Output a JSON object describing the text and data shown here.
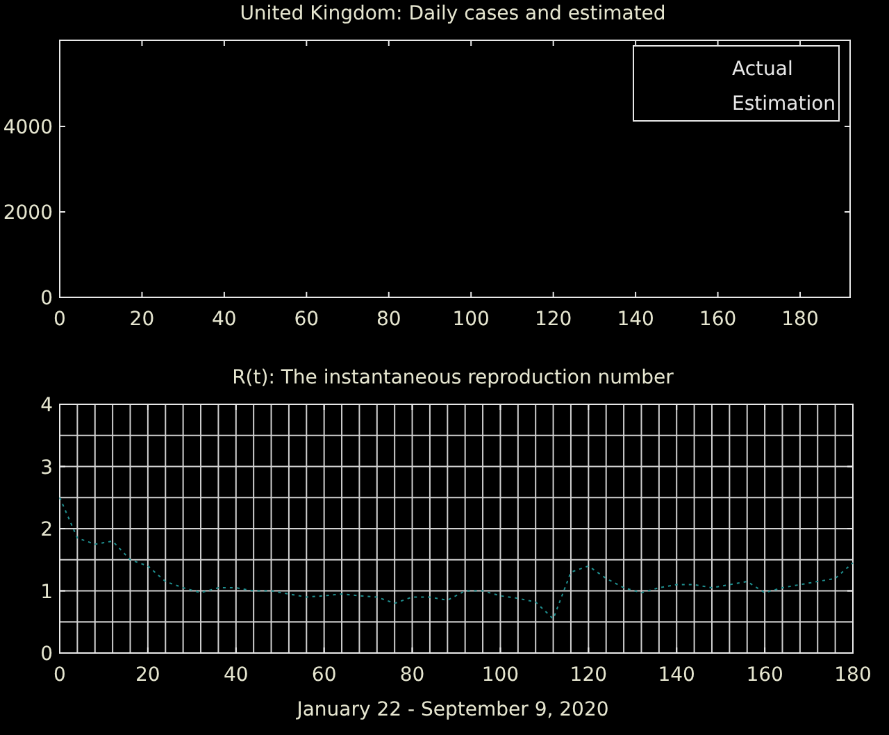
{
  "cases_panel": {
    "title": "United Kingdom: Daily cases and estimated",
    "x_ticks": [
      "0",
      "20",
      "40",
      "60",
      "80",
      "100",
      "120",
      "140",
      "160",
      "180"
    ],
    "y_ticks": [
      "4000",
      "2000",
      "0"
    ],
    "legend": [
      {
        "label": "Actual"
      },
      {
        "label": "Estimation"
      }
    ]
  },
  "r_chart": {
    "chart_data": {
      "type": "line",
      "title": "R(t): The instantaneous reproduction number",
      "xlabel": "January 22 - September 9, 2020",
      "xlim": [
        0,
        180
      ],
      "ylim": [
        0,
        4
      ],
      "xticks": [
        0,
        20,
        40,
        60,
        80,
        100,
        120,
        140,
        160,
        180
      ],
      "yticks": [
        0,
        1,
        2,
        3,
        4
      ],
      "x": [
        0,
        4,
        8,
        12,
        16,
        20,
        24,
        28,
        32,
        36,
        40,
        44,
        48,
        52,
        56,
        60,
        64,
        68,
        72,
        76,
        80,
        84,
        88,
        92,
        96,
        100,
        104,
        108,
        112,
        116,
        120,
        124,
        128,
        132,
        136,
        140,
        144,
        148,
        152,
        156,
        160,
        164,
        168,
        172,
        176,
        180
      ],
      "series": [
        {
          "color": "#1f8f8f",
          "line_style": "dotted",
          "values": [
            2.5,
            1.85,
            1.75,
            1.8,
            1.5,
            1.4,
            1.15,
            1.05,
            0.97,
            1.05,
            1.05,
            1.0,
            1.0,
            0.95,
            0.9,
            0.92,
            0.95,
            0.92,
            0.9,
            0.8,
            0.9,
            0.9,
            0.85,
            1.0,
            1.0,
            0.92,
            0.88,
            0.82,
            0.55,
            1.3,
            1.4,
            1.2,
            1.05,
            0.97,
            1.05,
            1.1,
            1.1,
            1.05,
            1.1,
            1.15,
            0.97,
            1.05,
            1.1,
            1.15,
            1.2,
            1.45
          ]
        }
      ],
      "grid": true
    }
  }
}
